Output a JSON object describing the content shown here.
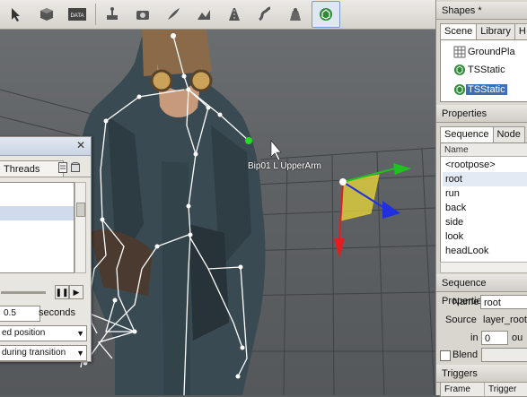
{
  "toolbar": {
    "buttons": [
      {
        "icon": "select-arrow-icon"
      },
      {
        "icon": "cube-icon"
      },
      {
        "icon": "data-icon",
        "label": "DATA"
      },
      {
        "icon": "joystick-icon"
      },
      {
        "icon": "camera-icon"
      },
      {
        "icon": "brush-icon"
      },
      {
        "icon": "terrain-brush-icon"
      },
      {
        "icon": "road-icon"
      },
      {
        "icon": "river-icon"
      },
      {
        "icon": "mesh-road-icon"
      },
      {
        "icon": "gizmo-icon",
        "active": true
      }
    ]
  },
  "viewport": {
    "bone_label": "Bip01 L UpperArm",
    "colors": {
      "bone": "#ffffff",
      "selected_bone": "#22dd22",
      "axis_x": "#e02020",
      "axis_y": "#20c020",
      "axis_z": "#2030e0",
      "plane": "#ecd93a"
    }
  },
  "threads": {
    "tab": "Threads",
    "duration": "0.5",
    "duration_unit": "seconds",
    "combo1": "ed position",
    "combo2": "during transition"
  },
  "shapes": {
    "title": "Shapes *",
    "tabs": [
      "Scene",
      "Library",
      "H"
    ],
    "items": [
      {
        "label": "GroundPla",
        "icon": "grid-icon"
      },
      {
        "label": "TSStatic",
        "icon": "shape-icon"
      },
      {
        "label": "TSStatic",
        "icon": "shape-icon",
        "selected": true
      }
    ]
  },
  "properties": {
    "title": "Properties",
    "tabs": [
      "Sequence",
      "Node"
    ],
    "name_header": "Name",
    "sequences": [
      "<rootpose>",
      "root",
      "run",
      "back",
      "side",
      "look",
      "headLook"
    ],
    "selected_sequence": "root"
  },
  "seq_props": {
    "title": "Sequence Properties",
    "name_label": "Name",
    "name_value": "root",
    "source_label": "Source",
    "source_value": "layer_root.",
    "in_label": "in",
    "in_value": "0",
    "out_label": "ou",
    "blend_label": "Blend"
  },
  "triggers": {
    "title": "Triggers",
    "columns": [
      "Frame",
      "Trigger"
    ]
  }
}
